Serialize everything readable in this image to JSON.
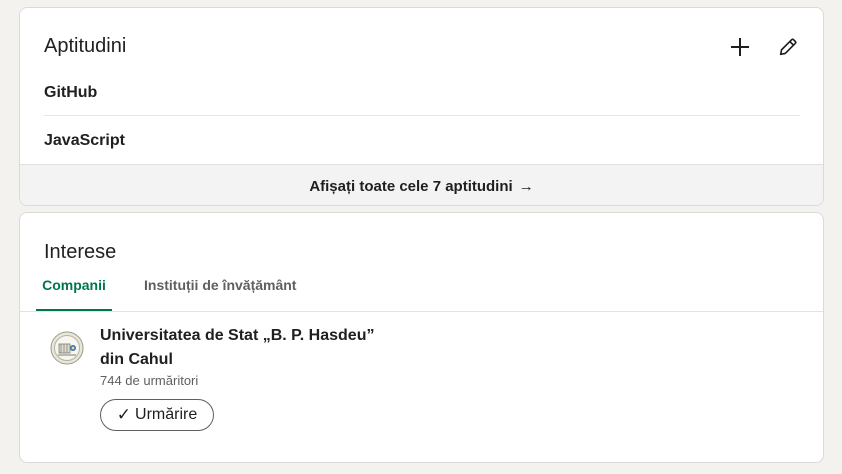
{
  "skills_section": {
    "title": "Aptitudini",
    "add_icon": "plus-icon",
    "edit_icon": "pencil-icon",
    "items": [
      {
        "label": "GitHub"
      },
      {
        "label": "JavaScript"
      }
    ],
    "show_all_label": "Afișați toate cele 7 aptitudini",
    "show_all_arrow": "→"
  },
  "interests_section": {
    "title": "Interese",
    "tabs": [
      {
        "label": "Companii",
        "active": true
      },
      {
        "label": "Instituții de învățământ",
        "active": false
      }
    ],
    "entity": {
      "logo_icon": "university-seal-logo",
      "name": "Universitatea de Stat „B. P. Hasdeu” din Cahul",
      "followers": "744 de urmăritori",
      "follow_button_check": "✓",
      "follow_button_label": "Urmărire"
    }
  },
  "colors": {
    "accent_green": "#01754f",
    "background": "#f4f2ee",
    "card": "#ffffff"
  }
}
